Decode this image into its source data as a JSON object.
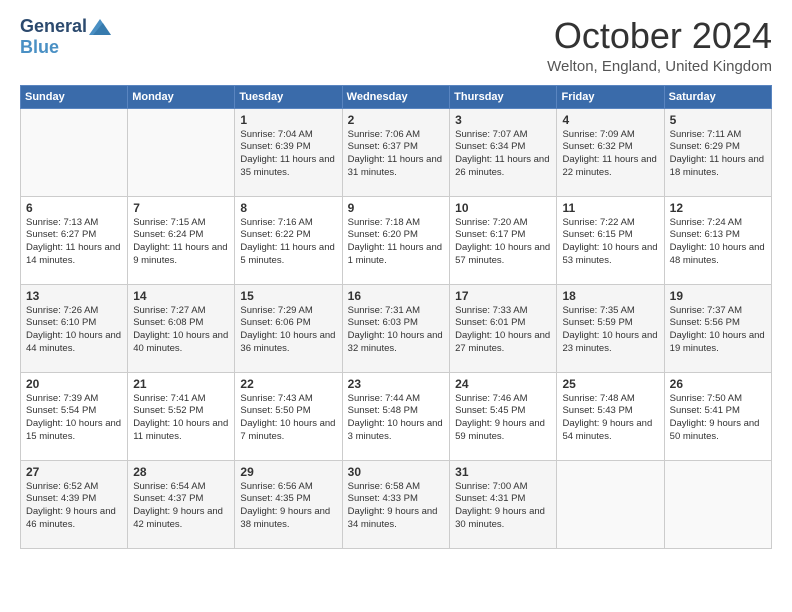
{
  "logo": {
    "general": "General",
    "blue": "Blue"
  },
  "title": "October 2024",
  "location": "Welton, England, United Kingdom",
  "days_of_week": [
    "Sunday",
    "Monday",
    "Tuesday",
    "Wednesday",
    "Thursday",
    "Friday",
    "Saturday"
  ],
  "weeks": [
    [
      {
        "day": "",
        "info": ""
      },
      {
        "day": "",
        "info": ""
      },
      {
        "day": "1",
        "info": "Sunrise: 7:04 AM\nSunset: 6:39 PM\nDaylight: 11 hours and 35 minutes."
      },
      {
        "day": "2",
        "info": "Sunrise: 7:06 AM\nSunset: 6:37 PM\nDaylight: 11 hours and 31 minutes."
      },
      {
        "day": "3",
        "info": "Sunrise: 7:07 AM\nSunset: 6:34 PM\nDaylight: 11 hours and 26 minutes."
      },
      {
        "day": "4",
        "info": "Sunrise: 7:09 AM\nSunset: 6:32 PM\nDaylight: 11 hours and 22 minutes."
      },
      {
        "day": "5",
        "info": "Sunrise: 7:11 AM\nSunset: 6:29 PM\nDaylight: 11 hours and 18 minutes."
      }
    ],
    [
      {
        "day": "6",
        "info": "Sunrise: 7:13 AM\nSunset: 6:27 PM\nDaylight: 11 hours and 14 minutes."
      },
      {
        "day": "7",
        "info": "Sunrise: 7:15 AM\nSunset: 6:24 PM\nDaylight: 11 hours and 9 minutes."
      },
      {
        "day": "8",
        "info": "Sunrise: 7:16 AM\nSunset: 6:22 PM\nDaylight: 11 hours and 5 minutes."
      },
      {
        "day": "9",
        "info": "Sunrise: 7:18 AM\nSunset: 6:20 PM\nDaylight: 11 hours and 1 minute."
      },
      {
        "day": "10",
        "info": "Sunrise: 7:20 AM\nSunset: 6:17 PM\nDaylight: 10 hours and 57 minutes."
      },
      {
        "day": "11",
        "info": "Sunrise: 7:22 AM\nSunset: 6:15 PM\nDaylight: 10 hours and 53 minutes."
      },
      {
        "day": "12",
        "info": "Sunrise: 7:24 AM\nSunset: 6:13 PM\nDaylight: 10 hours and 48 minutes."
      }
    ],
    [
      {
        "day": "13",
        "info": "Sunrise: 7:26 AM\nSunset: 6:10 PM\nDaylight: 10 hours and 44 minutes."
      },
      {
        "day": "14",
        "info": "Sunrise: 7:27 AM\nSunset: 6:08 PM\nDaylight: 10 hours and 40 minutes."
      },
      {
        "day": "15",
        "info": "Sunrise: 7:29 AM\nSunset: 6:06 PM\nDaylight: 10 hours and 36 minutes."
      },
      {
        "day": "16",
        "info": "Sunrise: 7:31 AM\nSunset: 6:03 PM\nDaylight: 10 hours and 32 minutes."
      },
      {
        "day": "17",
        "info": "Sunrise: 7:33 AM\nSunset: 6:01 PM\nDaylight: 10 hours and 27 minutes."
      },
      {
        "day": "18",
        "info": "Sunrise: 7:35 AM\nSunset: 5:59 PM\nDaylight: 10 hours and 23 minutes."
      },
      {
        "day": "19",
        "info": "Sunrise: 7:37 AM\nSunset: 5:56 PM\nDaylight: 10 hours and 19 minutes."
      }
    ],
    [
      {
        "day": "20",
        "info": "Sunrise: 7:39 AM\nSunset: 5:54 PM\nDaylight: 10 hours and 15 minutes."
      },
      {
        "day": "21",
        "info": "Sunrise: 7:41 AM\nSunset: 5:52 PM\nDaylight: 10 hours and 11 minutes."
      },
      {
        "day": "22",
        "info": "Sunrise: 7:43 AM\nSunset: 5:50 PM\nDaylight: 10 hours and 7 minutes."
      },
      {
        "day": "23",
        "info": "Sunrise: 7:44 AM\nSunset: 5:48 PM\nDaylight: 10 hours and 3 minutes."
      },
      {
        "day": "24",
        "info": "Sunrise: 7:46 AM\nSunset: 5:45 PM\nDaylight: 9 hours and 59 minutes."
      },
      {
        "day": "25",
        "info": "Sunrise: 7:48 AM\nSunset: 5:43 PM\nDaylight: 9 hours and 54 minutes."
      },
      {
        "day": "26",
        "info": "Sunrise: 7:50 AM\nSunset: 5:41 PM\nDaylight: 9 hours and 50 minutes."
      }
    ],
    [
      {
        "day": "27",
        "info": "Sunrise: 6:52 AM\nSunset: 4:39 PM\nDaylight: 9 hours and 46 minutes."
      },
      {
        "day": "28",
        "info": "Sunrise: 6:54 AM\nSunset: 4:37 PM\nDaylight: 9 hours and 42 minutes."
      },
      {
        "day": "29",
        "info": "Sunrise: 6:56 AM\nSunset: 4:35 PM\nDaylight: 9 hours and 38 minutes."
      },
      {
        "day": "30",
        "info": "Sunrise: 6:58 AM\nSunset: 4:33 PM\nDaylight: 9 hours and 34 minutes."
      },
      {
        "day": "31",
        "info": "Sunrise: 7:00 AM\nSunset: 4:31 PM\nDaylight: 9 hours and 30 minutes."
      },
      {
        "day": "",
        "info": ""
      },
      {
        "day": "",
        "info": ""
      }
    ]
  ]
}
